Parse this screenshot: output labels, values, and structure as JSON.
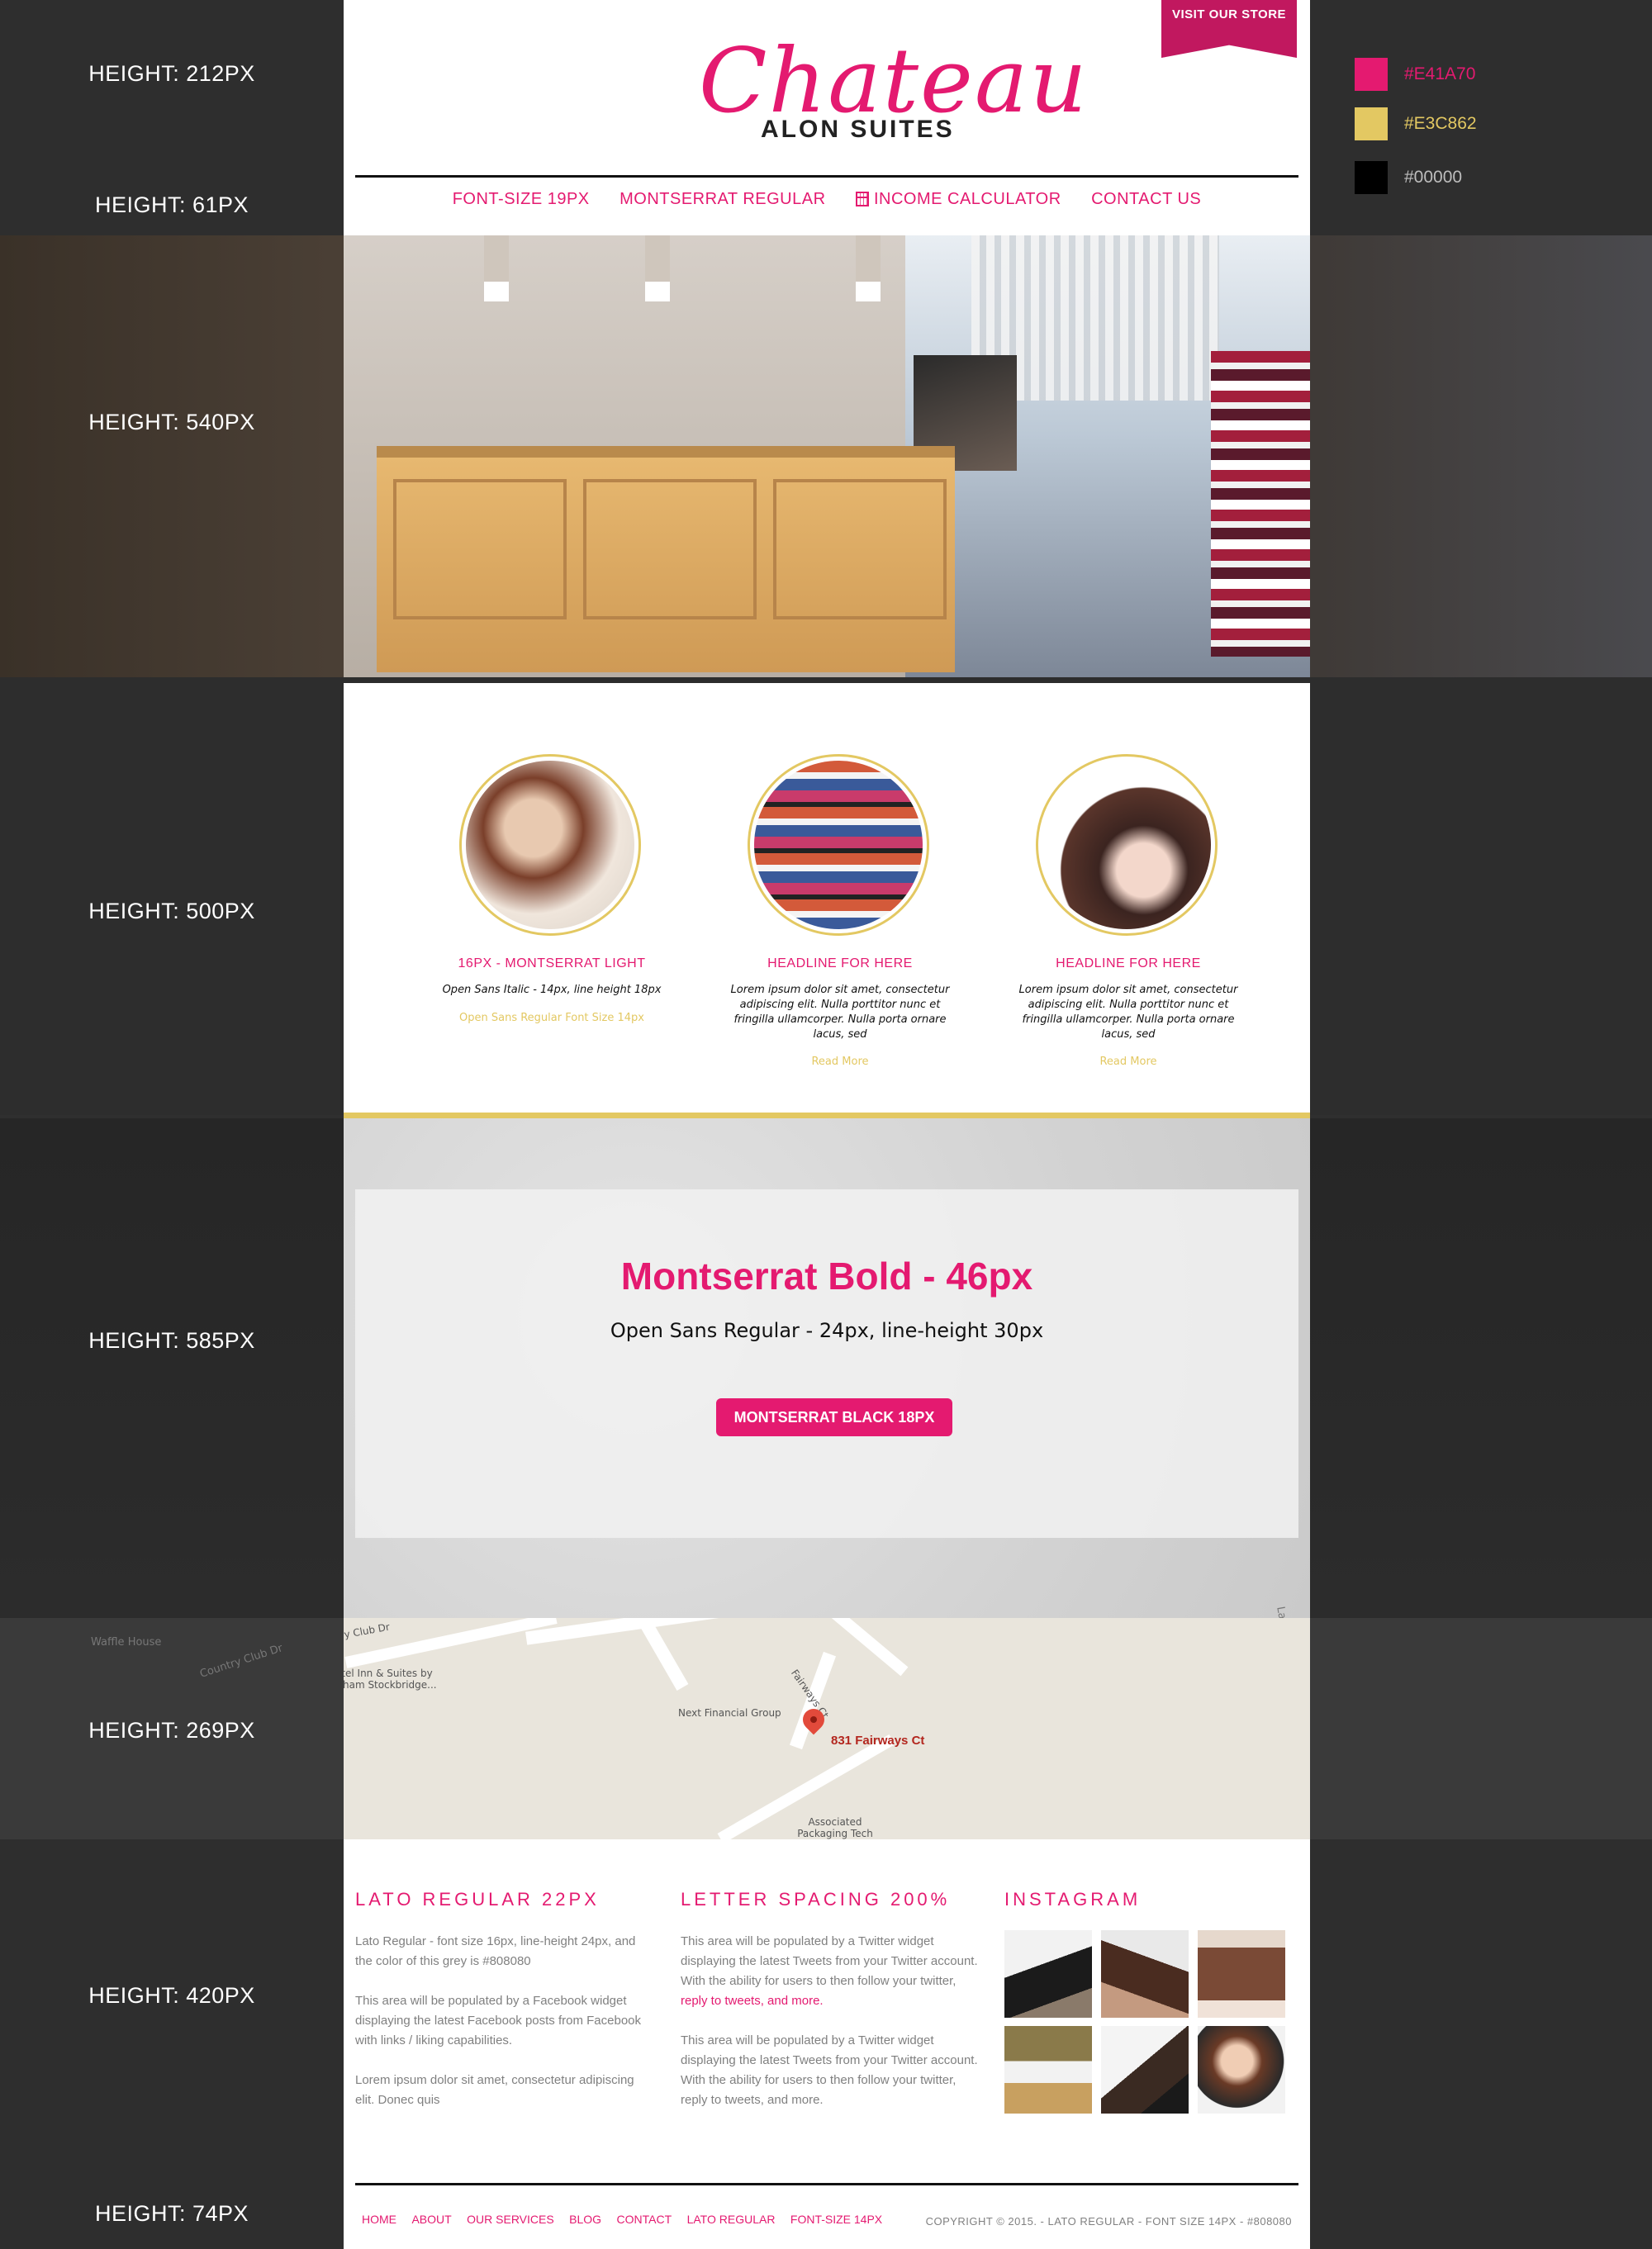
{
  "annotations": {
    "header": "HEIGHT: 212PX",
    "nav": "HEIGHT: 61PX",
    "hero": "HEIGHT: 540PX",
    "features": "HEIGHT: 500PX",
    "cta": "HEIGHT: 585PX",
    "map": "HEIGHT:  269PX",
    "widgets": "HEIGHT:  420PX",
    "footer": "HEIGHT:  74PX"
  },
  "header": {
    "logo_script": "Chateau",
    "logo_sub": "ALON SUITES",
    "ribbon_label": "VISIT OUR STORE"
  },
  "nav": {
    "items": [
      "FONT-SIZE 19PX",
      "MONTSERRAT REGULAR",
      "INCOME CALCULATOR",
      "CONTACT US"
    ]
  },
  "palette": [
    {
      "label": "#E41A70",
      "color": "#E41A70"
    },
    {
      "label": "#E3C862",
      "color": "#E3C862"
    },
    {
      "label": "#00000",
      "color": "#000000"
    }
  ],
  "features": [
    {
      "title": "16PX - MONTSERRAT LIGHT",
      "desc": "Open Sans Italic - 14px, line height 18px",
      "more": "Open Sans Regular Font Size 14px"
    },
    {
      "title": "HEADLINE FOR HERE",
      "desc": "Lorem ipsum dolor sit amet, consectetur adipiscing elit. Nulla porttitor nunc et fringilla ullamcorper. Nulla porta ornare lacus, sed",
      "more": "Read More"
    },
    {
      "title": "HEADLINE FOR HERE",
      "desc": "Lorem ipsum dolor sit amet, consectetur adipiscing elit. Nulla porttitor nunc et fringilla ullamcorper. Nulla porta ornare lacus, sed",
      "more": "Read More"
    }
  ],
  "cta": {
    "title": "Montserrat Bold - 46px",
    "subtitle": "Open Sans Regular - 24px, line-height 30px",
    "button": "MONTSERRAT BLACK 18PX"
  },
  "map": {
    "address": "831 Fairways Ct",
    "labels": [
      "Next Financial Group",
      "Associated Packaging Tech",
      "Microtel Inn & Suites by Wyndham Stockbridge...",
      "Country Club Dr",
      "Fairways Ct",
      "Waffle House",
      "Country Club Dr",
      "Landing Way"
    ]
  },
  "widgets": {
    "col1": {
      "heading": "LATO REGULAR 22PX",
      "p1": "Lato Regular - font size 16px, line-height 24px, and the color of this grey is #808080",
      "p2": "This area will be populated by a Facebook widget displaying the latest Facebook posts from Facebook with links / liking capabilities.",
      "p3": "Lorem ipsum dolor sit amet, consectetur adipiscing elit. Donec quis"
    },
    "col2": {
      "heading": "LETTER SPACING 200%",
      "p1_text": "This area will be populated by a Twitter widget displaying the latest Tweets from your Twitter account. With the ability for users to then follow your twitter, ",
      "p1_link": "reply to tweets, and more.",
      "p2": "This area will be populated by a Twitter widget displaying the latest Tweets from your Twitter account. With the ability for users to then follow your twitter, reply to tweets, and more."
    },
    "col3": {
      "heading": "INSTAGRAM"
    }
  },
  "footer": {
    "links": [
      "HOME",
      "ABOUT",
      "OUR SERVICES",
      "BLOG",
      "CONTACT",
      "LATO REGULAR",
      "FONT-SIZE 14PX"
    ],
    "copyright": "COPYRIGHT © 2015. - LATO REGULAR - FONT SIZE 14PX - #808080"
  }
}
